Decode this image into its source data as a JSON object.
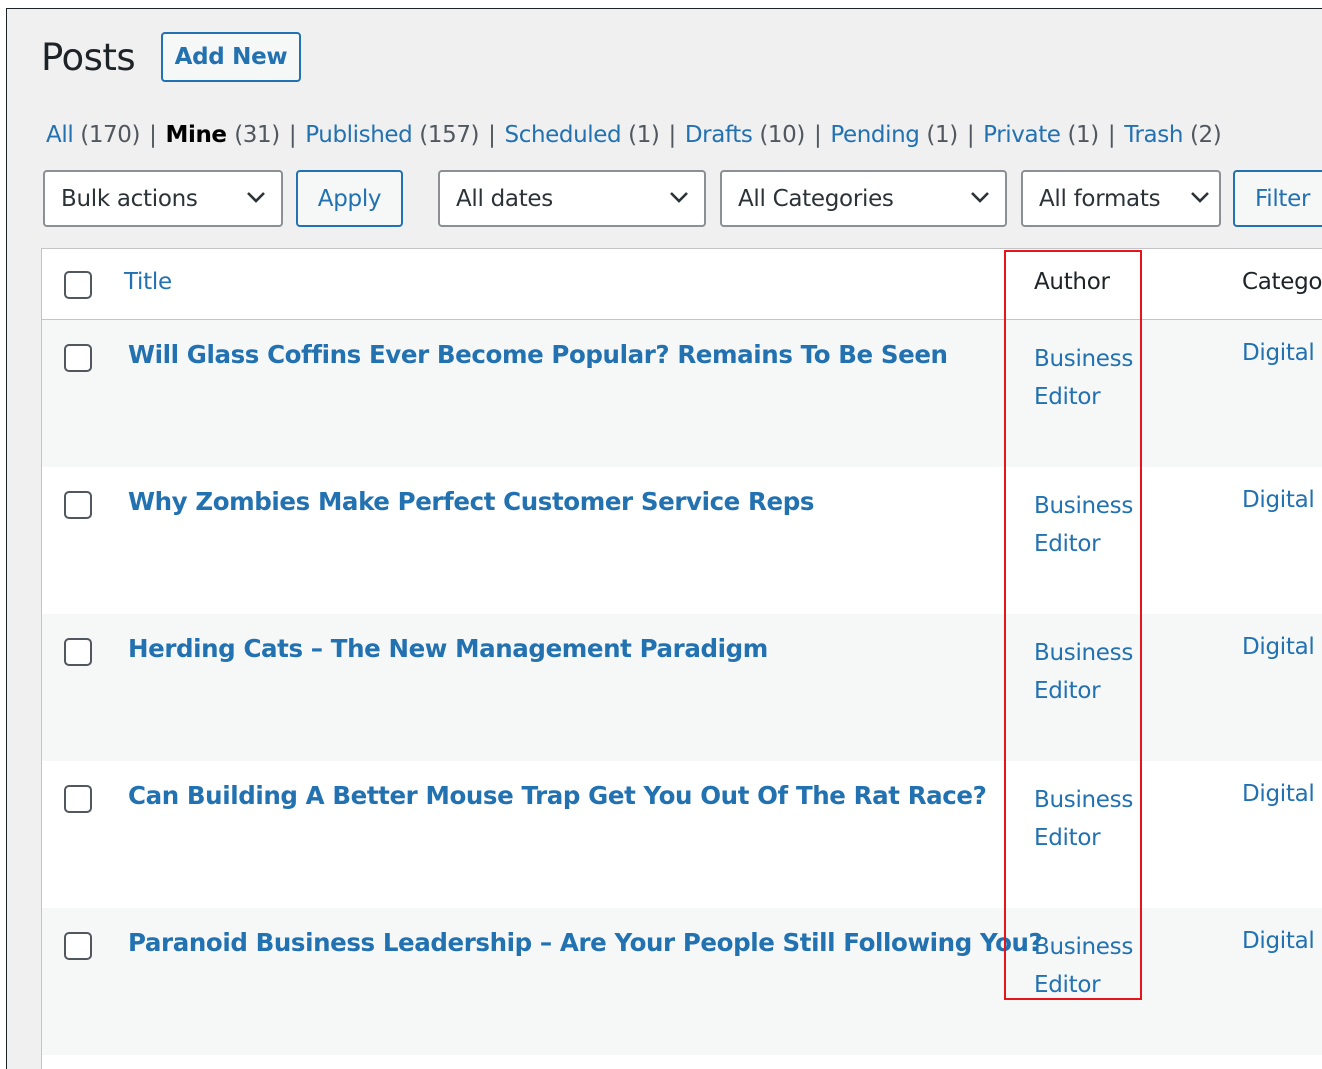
{
  "header": {
    "title": "Posts",
    "add_new_label": "Add New"
  },
  "views": [
    {
      "label": "All",
      "count": "(170)"
    },
    {
      "label": "Mine",
      "count": "(31)"
    },
    {
      "label": "Published",
      "count": "(157)"
    },
    {
      "label": "Scheduled",
      "count": "(1)"
    },
    {
      "label": "Drafts",
      "count": "(10)"
    },
    {
      "label": "Pending",
      "count": "(1)"
    },
    {
      "label": "Private",
      "count": "(1)"
    },
    {
      "label": "Trash",
      "count": "(2)"
    }
  ],
  "views_separator": "|",
  "current_view": "Mine",
  "filters": {
    "bulk_actions": "Bulk actions",
    "apply_label": "Apply",
    "dates": "All dates",
    "categories": "All Categories",
    "formats": "All formats",
    "filter_label": "Filter"
  },
  "table": {
    "columns": {
      "title": "Title",
      "author": "Author",
      "categories": "Catego"
    },
    "rows": [
      {
        "title": "Will Glass Coffins Ever Become Popular? Remains To Be Seen",
        "author_line1": "Business",
        "author_line2": "Editor",
        "category": "Digital"
      },
      {
        "title": "Why Zombies Make Perfect Customer Service Reps",
        "author_line1": "Business",
        "author_line2": "Editor",
        "category": "Digital"
      },
      {
        "title": "Herding Cats – The New Management Paradigm",
        "author_line1": "Business",
        "author_line2": "Editor",
        "category": "Digital"
      },
      {
        "title": "Can Building A Better Mouse Trap Get You Out Of The Rat Race?",
        "author_line1": "Business",
        "author_line2": "Editor",
        "category": "Digital"
      },
      {
        "title": "Paranoid Business Leadership – Are Your People Still Following You?",
        "author_line1": "Business",
        "author_line2": "Editor",
        "category": "Digital"
      }
    ]
  },
  "colors": {
    "link": "#2271b1",
    "highlight_box": "#e8141c",
    "background": "#f0f0f1"
  },
  "icons": {
    "select_arrow": "chevron-down-icon"
  }
}
